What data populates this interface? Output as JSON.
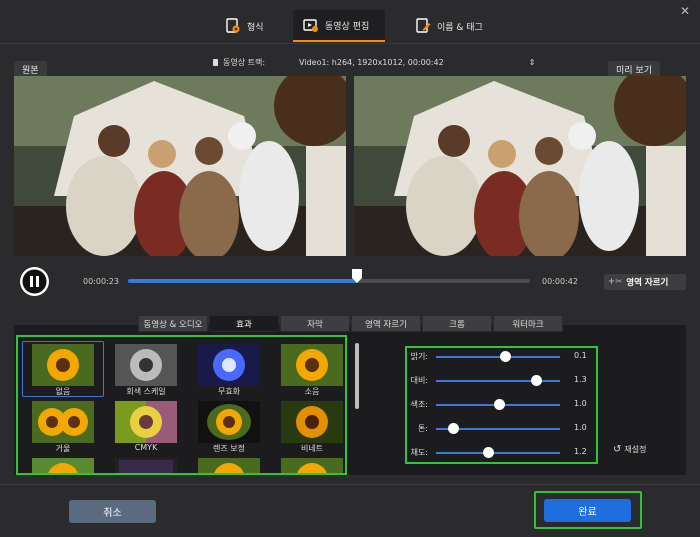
{
  "tabs": [
    {
      "label": "형식"
    },
    {
      "label": "동영상 편집"
    },
    {
      "label": "이름 & 태그"
    }
  ],
  "preview": {
    "original_label": "원본",
    "track_label": "동영상 트랙:",
    "track_value": "Video1: h264, 1920x1012, 00:00:42",
    "preview_label": "미리 보기"
  },
  "playback": {
    "current_time": "00:00:23",
    "total_time": "00:00:42",
    "progress": 0.57,
    "crop_area_label": "영역 자르기"
  },
  "feature_tabs": [
    "동영상 & 오디오",
    "효과",
    "자막",
    "영역 자르기",
    "크롭",
    "워터마크"
  ],
  "active_feature_tab": "효과",
  "filters": [
    "없음",
    "회색 스케일",
    "무효화",
    "소음",
    "거울",
    "CMYK",
    "렌즈 보정",
    "비네트"
  ],
  "selected_filter": "없음",
  "adjustments": [
    {
      "label": "밝기:",
      "value": "0.1"
    },
    {
      "label": "대비:",
      "value": "1.3"
    },
    {
      "label": "색조:",
      "value": "1.0"
    },
    {
      "label": "톤:",
      "value": "1.0"
    },
    {
      "label": "채도:",
      "value": "1.2"
    }
  ],
  "adjustments_reset": "재설정",
  "footer": {
    "cancel_label": "취소",
    "done_label": "완료"
  },
  "colors": {
    "accent": "#1f6ee0",
    "active_tab_underline": "#ff8a00",
    "highlight_box": "#2fc43a"
  }
}
